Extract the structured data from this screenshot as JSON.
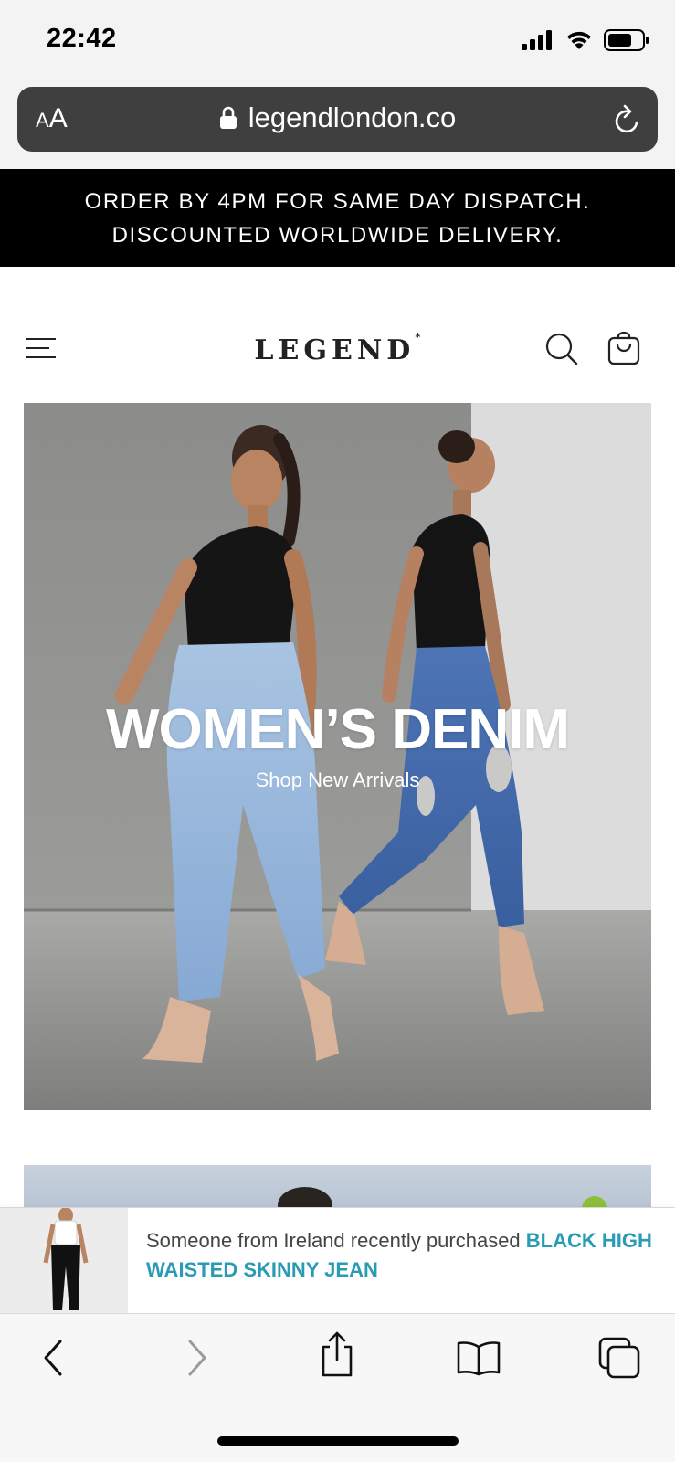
{
  "status_bar": {
    "time": "22:42",
    "icons": [
      "cellular-signal-icon",
      "wifi-icon",
      "battery-icon"
    ]
  },
  "browser": {
    "text_size_label_small": "A",
    "text_size_label_large": "A",
    "url": "legendlondon.co",
    "icons": [
      "lock-icon",
      "reload-icon"
    ],
    "toolbar_icons": [
      "back-icon",
      "forward-icon",
      "share-icon",
      "bookmarks-icon",
      "tabs-icon"
    ]
  },
  "announcement": {
    "line1": "ORDER BY 4PM FOR SAME DAY DISPATCH.",
    "line2": "DISCOUNTED WORLDWIDE DELIVERY."
  },
  "header": {
    "logo_text": "LEGEND",
    "logo_mark": "*",
    "icons": [
      "menu-icon",
      "search-icon",
      "shopping-bag-icon"
    ]
  },
  "hero": {
    "title": "WOMEN’S DENIM",
    "link_label": "Shop New Arrivals"
  },
  "purchase_notification": {
    "message": "Someone from Ireland recently purchased ",
    "product_name": "BLACK HIGH WAISTED SKINNY JEAN"
  },
  "colors": {
    "announcement_bg": "#000000",
    "product_link": "#2a9bb5",
    "address_bar_bg": "#3f3f3f"
  }
}
